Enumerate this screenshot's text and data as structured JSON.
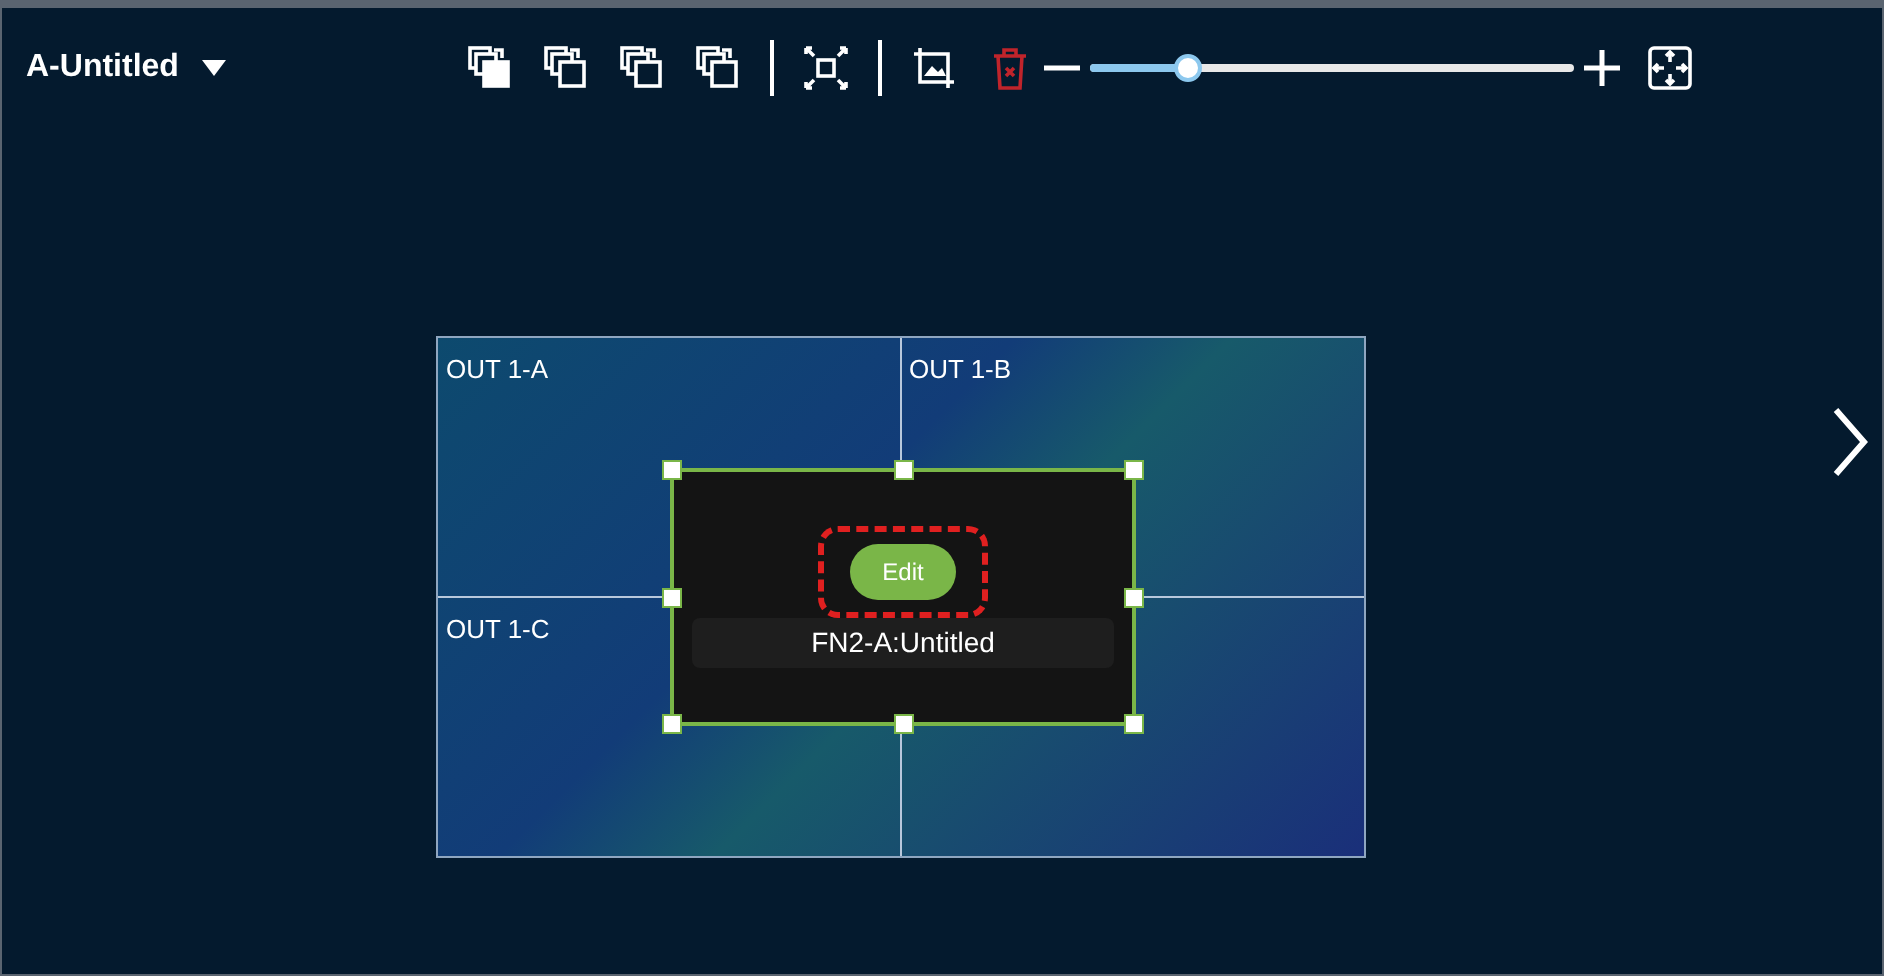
{
  "layout": {
    "title": "A-Untitled"
  },
  "zoom": {
    "level": 0.2
  },
  "outputs": [
    {
      "label": "OUT 1-A"
    },
    {
      "label": "OUT 1-B"
    },
    {
      "label": "OUT 1-C"
    }
  ],
  "window": {
    "label": "FN2-A:Untitled",
    "selected": true,
    "edit_button": "Edit"
  }
}
